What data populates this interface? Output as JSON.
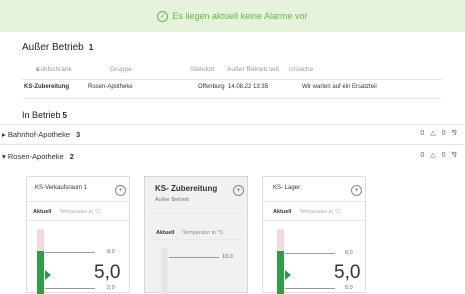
{
  "banner": {
    "text": "Es liegen aktuell keine Alarme vor"
  },
  "out_of_service": {
    "title": "Außer Betrieb",
    "count": "1",
    "headers": {
      "fridge": "Kühlschrank",
      "group": "Gruppe",
      "location": "Standort",
      "since": "Außer Betrieb seit",
      "reason": "Ursache"
    },
    "row": {
      "fridge": "KS-Zubereitung",
      "group": "Rosen-Apotheke",
      "location": "Offenburg",
      "since": "14.08.22 13:35",
      "reason": "Wir warten auf ein Ersatzteil"
    }
  },
  "in_service": {
    "title": "In Betrieb",
    "count": "5",
    "groups": [
      {
        "name": "Bahnhof-Apotheke",
        "count": "3",
        "icon_a": "0",
        "icon_b": "0"
      },
      {
        "name": "Rosen-Apotheke",
        "count": "2",
        "icon_a": "0",
        "icon_b": "0"
      }
    ]
  },
  "cards": [
    {
      "title": "KS-Verkaufsraum 1",
      "tab_active": "Aktuell",
      "tab_inactive": "Temperatur in °C",
      "top_label": "8,0",
      "value": "5,0",
      "low_label": "2,0"
    },
    {
      "title": "KS- Zubereitung",
      "subtitle": "Außer Betrieb",
      "tab_active": "Aktuell",
      "tab_inactive": "Temperatur in °C",
      "top_label": "10,0"
    },
    {
      "title": "KS- Lager",
      "tab_active": "Aktuell",
      "tab_inactive": "Temperatur in °C",
      "top_label": "8,0",
      "value": "5,0",
      "low_label": "5,0"
    }
  ]
}
